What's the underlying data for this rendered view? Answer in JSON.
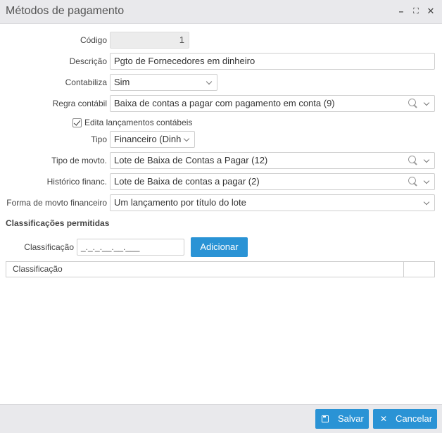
{
  "window": {
    "title": "Métodos de pagamento"
  },
  "form": {
    "codigo": {
      "label": "Código",
      "value": "1"
    },
    "descricao": {
      "label": "Descrição",
      "value": "Pgto de Fornecedores em dinheiro"
    },
    "contabiliza": {
      "label": "Contabiliza",
      "value": "Sim"
    },
    "regra_contabil": {
      "label": "Regra contábil",
      "value": "Baixa de contas a pagar com pagamento em conta (9)"
    },
    "edita_lancamentos": {
      "label": "Edita lançamentos contábeis",
      "checked": true
    },
    "tipo": {
      "label": "Tipo",
      "value": "Financeiro (Dinh"
    },
    "tipo_movto": {
      "label": "Tipo de movto.",
      "value": "Lote de Baixa de Contas a Pagar (12)"
    },
    "historico_financ": {
      "label": "Histórico financ.",
      "value": "Lote de Baixa de contas a pagar (2)"
    },
    "forma_movto": {
      "label": "Forma de movto financeiro",
      "value": "Um lançamento por título do lote"
    }
  },
  "classificacoes": {
    "title": "Classificações permitidas",
    "field_label": "Classificação",
    "field_mask": "_._._.__.__.___",
    "add_label": "Adicionar",
    "grid_header": "Classificação"
  },
  "footer": {
    "save_label": "Salvar",
    "cancel_label": "Cancelar"
  }
}
